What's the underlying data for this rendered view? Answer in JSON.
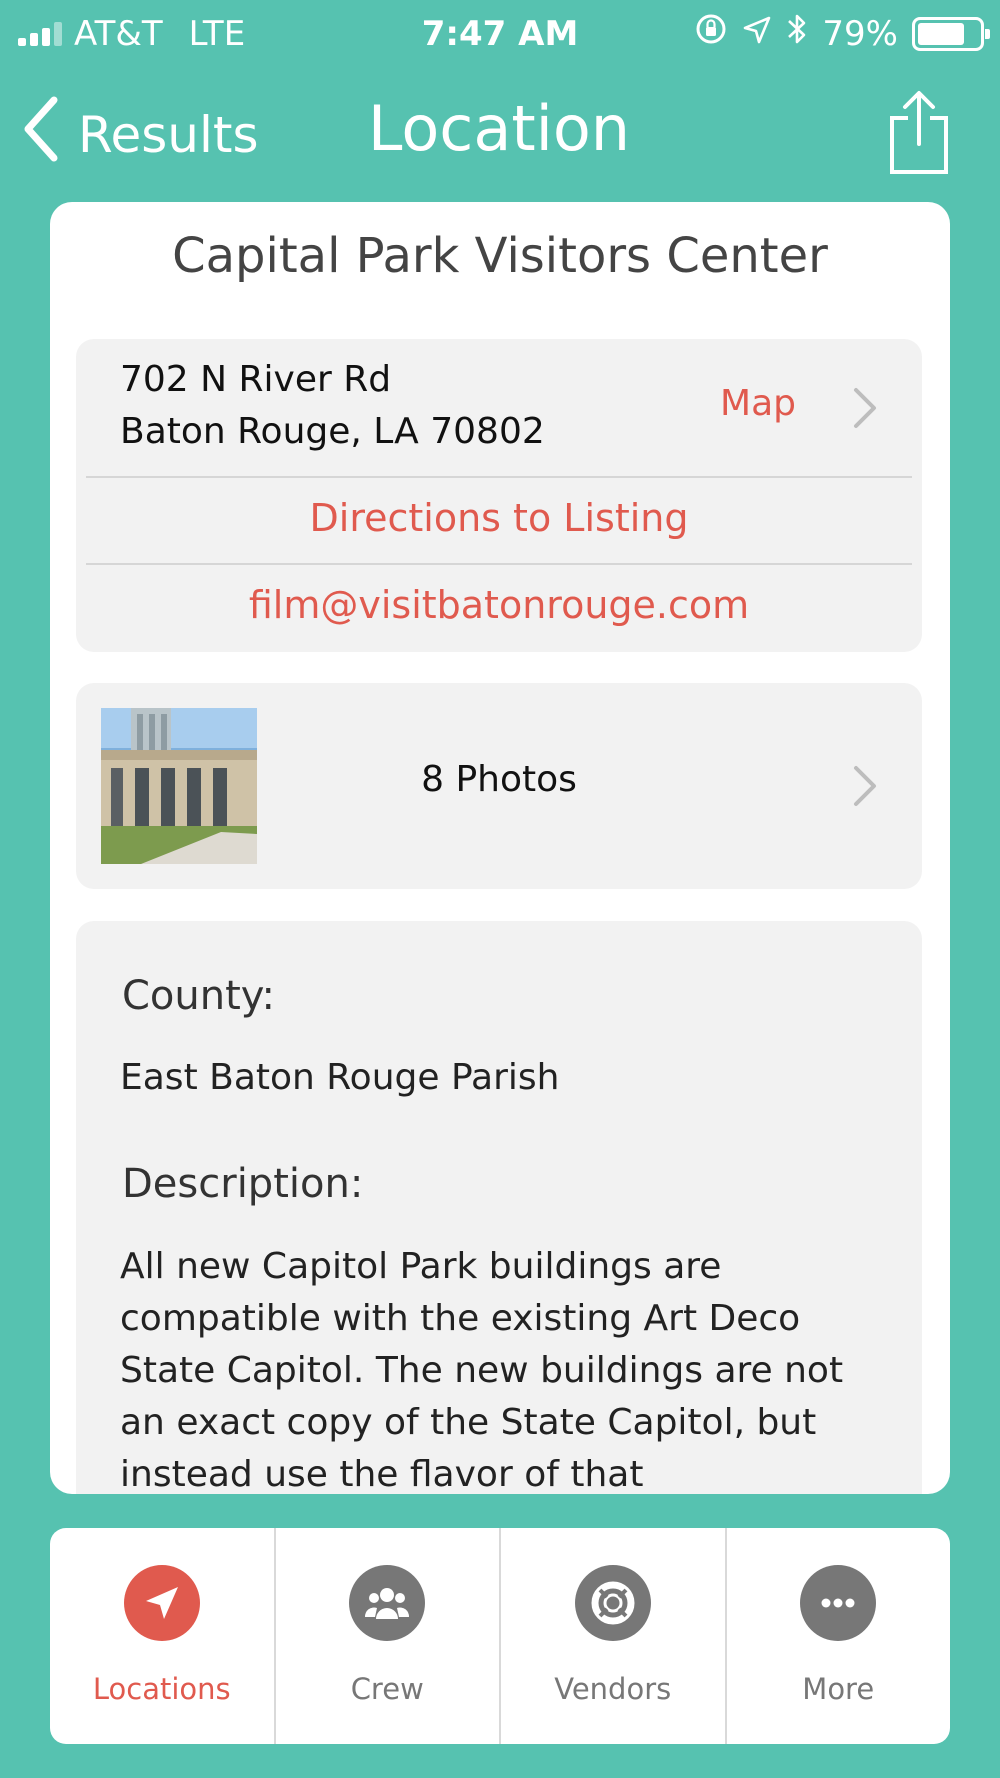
{
  "status_bar": {
    "carrier": "AT&T",
    "network": "LTE",
    "time": "7:47 AM",
    "battery_percent": "79%",
    "battery_level": 0.79,
    "icons": [
      "signal-icon",
      "orientation-lock-icon",
      "location-arrow-icon",
      "bluetooth-icon",
      "battery-icon"
    ]
  },
  "nav": {
    "back_label": "Results",
    "title": "Location",
    "share_icon": "share-icon"
  },
  "place": {
    "title": "Capital Park Visitors Center",
    "address_line1": "702 N River Rd",
    "address_line2": "Baton Rouge, LA 70802",
    "map_label": "Map",
    "directions_label": "Directions to Listing",
    "email": "film@visitbatonrouge.com",
    "photos_label": "8 Photos",
    "county_heading": "County:",
    "county_value": "East Baton Rouge Parish",
    "description_heading": "Description:",
    "description_text": "All new Capitol Park buildings are compatible with the existing Art Deco State Capitol. The new buildings are not an exact copy of the State Capitol, but instead use the flavor of that"
  },
  "tabs": [
    {
      "label": "Locations",
      "icon": "location-arrow-icon",
      "active": true
    },
    {
      "label": "Crew",
      "icon": "group-icon",
      "active": false
    },
    {
      "label": "Vendors",
      "icon": "lifebuoy-icon",
      "active": false
    },
    {
      "label": "More",
      "icon": "more-dots-icon",
      "active": false
    }
  ],
  "colors": {
    "background": "#56c2b0",
    "accent": "#e05a4e",
    "panel": "#f2f2f2",
    "inactive_tab": "#777777"
  }
}
